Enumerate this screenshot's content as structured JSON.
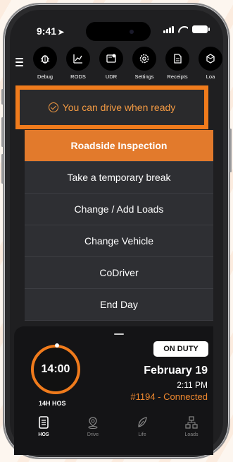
{
  "status_bar": {
    "time": "9:41",
    "location_arrow": "➤"
  },
  "toolbar": {
    "items": [
      {
        "label": "Debug",
        "icon": "bug-icon"
      },
      {
        "label": "RODS",
        "icon": "chart-icon"
      },
      {
        "label": "UDR",
        "icon": "udr-icon"
      },
      {
        "label": "Settings",
        "icon": "gear-icon"
      },
      {
        "label": "Receipts",
        "icon": "receipt-icon"
      },
      {
        "label": "Loa",
        "icon": "box-icon"
      }
    ]
  },
  "banner": {
    "text": "You can drive when ready",
    "accent": "#f07b1c"
  },
  "menu": {
    "items": [
      {
        "label": "Roadside Inspection"
      },
      {
        "label": "Take a temporary break"
      },
      {
        "label": "Change / Add Loads"
      },
      {
        "label": "Change Vehicle"
      },
      {
        "label": "CoDriver"
      },
      {
        "label": "End Day"
      }
    ]
  },
  "status_panel": {
    "clock_value": "14:00",
    "hos_label": "14H HOS",
    "duty_status": "ON DUTY",
    "date": "February 19",
    "time": "2:11 PM",
    "connection": "#1194 - Connected"
  },
  "tabs": {
    "items": [
      {
        "label": "HOS",
        "icon": "document-icon",
        "active": true
      },
      {
        "label": "Drive",
        "icon": "location-icon",
        "active": false
      },
      {
        "label": "Life",
        "icon": "leaf-icon",
        "active": false
      },
      {
        "label": "Loads",
        "icon": "network-icon",
        "active": false
      }
    ]
  }
}
